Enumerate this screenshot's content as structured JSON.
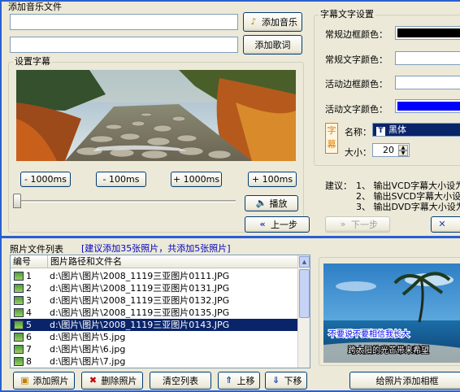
{
  "music": {
    "group_title": "添加音乐文件",
    "add_music_button": "添加音乐",
    "add_lyrics_button": "添加歌词",
    "music_path": "",
    "lyrics_path": ""
  },
  "subtitle": {
    "group_title": "设置字幕",
    "seek_buttons": [
      "- 1000ms",
      "- 100ms",
      "+ 1000ms",
      "+ 100ms"
    ],
    "play_button": "播放",
    "prev_button": "上一步",
    "next_button": "下一步",
    "slider_position": 0.0
  },
  "text_settings": {
    "group_title": "字幕文字设置",
    "rows": [
      {
        "label": "常规边框颜色：",
        "color": "#000000"
      },
      {
        "label": "常规文字颜色：",
        "color": "#ffffff"
      },
      {
        "label": "活动边框颜色：",
        "color": "#ffffff"
      },
      {
        "label": "活动文字颜色：",
        "color": "#0000ff"
      }
    ],
    "font_icon_text": "字幕",
    "name_label": "名称：",
    "font_name": "黑体",
    "size_label": "大小：",
    "font_size": "20"
  },
  "suggestion": {
    "prefix": "建议：",
    "lines": [
      "1、 输出VCD字幕大小设为",
      "2、 输出SVCD字幕大小设",
      "3、 输出DVD字幕大小设为"
    ]
  },
  "photos": {
    "group_title": "照片文件列表",
    "hint": "[建议添加35张照片，共添加5张照片]",
    "columns": [
      "编号",
      "图片路径和文件名"
    ],
    "rows": [
      {
        "num": "1",
        "path": "d:\\图片\\图片\\2008_1119三亚图片0111.JPG"
      },
      {
        "num": "2",
        "path": "d:\\图片\\图片\\2008_1119三亚图片0131.JPG"
      },
      {
        "num": "3",
        "path": "d:\\图片\\图片\\2008_1119三亚图片0132.JPG"
      },
      {
        "num": "4",
        "path": "d:\\图片\\图片\\2008_1119三亚图片0135.JPG"
      },
      {
        "num": "5",
        "path": "d:\\图片\\图片\\2008_1119三亚图片0143.JPG"
      },
      {
        "num": "6",
        "path": "d:\\图片\\图片\\5.jpg"
      },
      {
        "num": "7",
        "path": "d:\\图片\\图片\\6.jpg"
      },
      {
        "num": "8",
        "path": "d:\\图片\\图片\\7.jpg"
      }
    ],
    "selected_index": 4,
    "add_button": "添加照片",
    "delete_button": "删除照片",
    "clear_button": "清空列表",
    "up_button": "上移",
    "down_button": "下移",
    "frame_button": "给照片添加相框"
  },
  "preview": {
    "subtitle_active": "不要说不要相信我长大",
    "subtitle_normal": "跨太阳的光芒带来希望"
  },
  "colors": {
    "window_bg": "#ece9d8",
    "border_blue": "#2a5fd0",
    "selection": "#0a246a",
    "hint_blue": "#0000c0",
    "font_icon_orange": "#e07b00"
  }
}
